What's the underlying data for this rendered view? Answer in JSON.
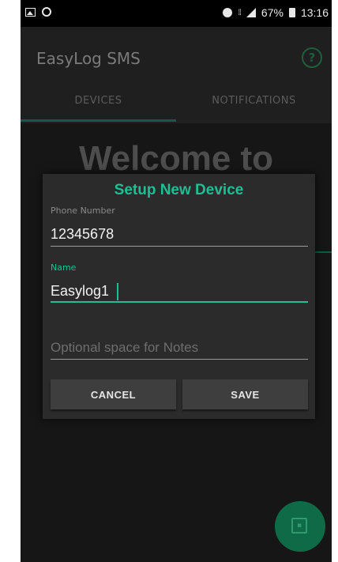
{
  "status_bar": {
    "battery_percent": "67%",
    "time": "13:16"
  },
  "app_bar": {
    "title": "EasyLog SMS",
    "help_glyph": "?"
  },
  "tabs": [
    {
      "label": "DEVICES",
      "selected": true
    },
    {
      "label": "NOTIFICATIONS",
      "selected": false
    }
  ],
  "welcome_text": "Welcome to",
  "dialog": {
    "title": "Setup New Device",
    "phone_label": "Phone Number",
    "phone_value": "12345678",
    "name_label": "Name",
    "name_value": "Easylog1",
    "notes_placeholder": "Optional space for Notes",
    "cancel_label": "CANCEL",
    "save_label": "SAVE"
  },
  "colors": {
    "accent": "#1dbf95",
    "fab": "#0f6b47",
    "dialog_bg": "#2b2b2b"
  },
  "icons": {
    "fab": "add-device-icon",
    "help": "help-icon"
  }
}
